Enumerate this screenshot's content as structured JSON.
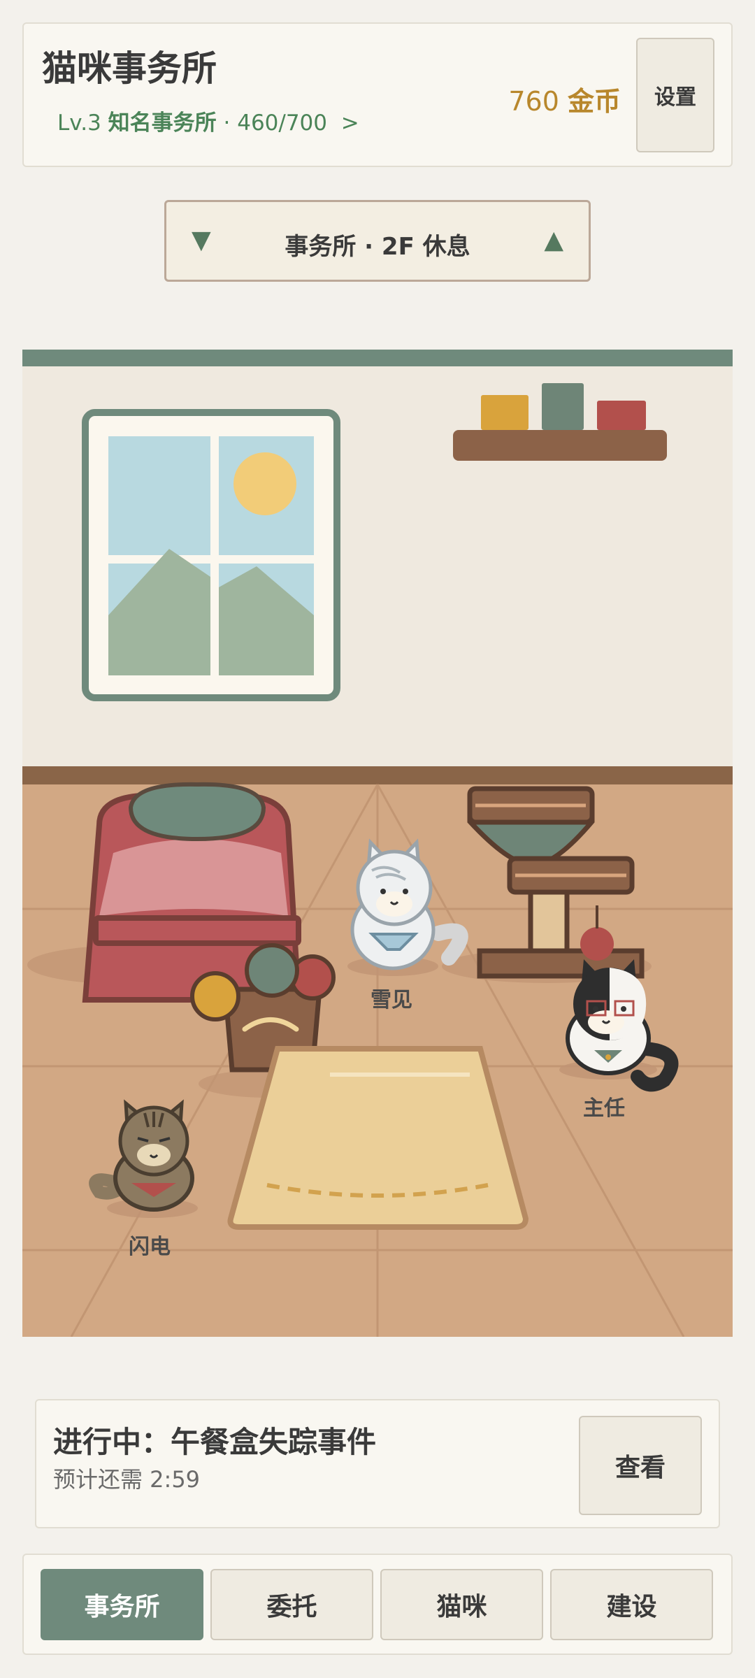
{
  "header": {
    "title": "猫咪事务所",
    "level_prefix": "Lv.3 ",
    "level_rank": "知名事务所",
    "level_progress": " · 460/700",
    "level_arrow": ">",
    "coins_value": "760",
    "coins_unit": "金币",
    "settings_label": "设置"
  },
  "floor_selector": {
    "down_arrow": "▼",
    "label": "事务所 · 2F 休息",
    "up_arrow": "▲"
  },
  "scene": {
    "cats": [
      {
        "name": "雪见",
        "color": "#e8ecee"
      },
      {
        "name": "主任",
        "color": "#2e2e2e"
      },
      {
        "name": "闪电",
        "color": "#8c7a60"
      }
    ],
    "colors": {
      "wall": "#efe9df",
      "wall_trim": "#6f8a7c",
      "floor": "#d4a884",
      "baseboard": "#8a6548"
    }
  },
  "task": {
    "title": "进行中：午餐盒失踪事件",
    "eta": "预计还需 2:59",
    "view_label": "查看"
  },
  "nav": {
    "tabs": [
      {
        "label": "事务所",
        "active": true
      },
      {
        "label": "委托",
        "active": false
      },
      {
        "label": "猫咪",
        "active": false
      },
      {
        "label": "建设",
        "active": false
      }
    ]
  }
}
